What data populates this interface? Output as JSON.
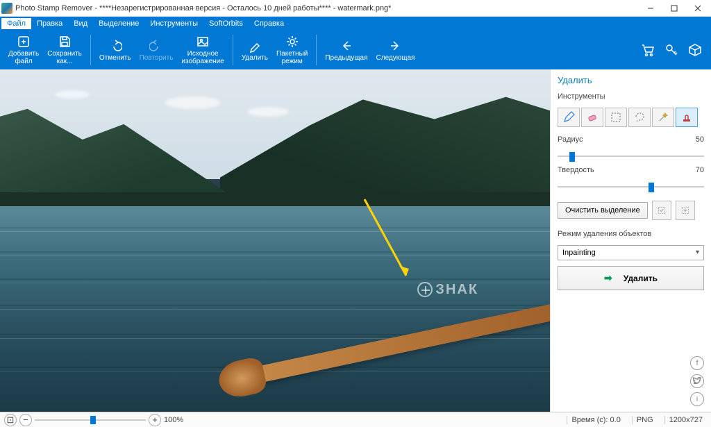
{
  "window": {
    "title": "Photo Stamp Remover - ****Незарегистрированная версия - Осталось 10 дней работы**** - watermark.png*"
  },
  "menu": {
    "file": "Файл",
    "edit": "Правка",
    "view": "Вид",
    "selection": "Выделение",
    "tools": "Инструменты",
    "softorbits": "SoftOrbits",
    "help": "Справка"
  },
  "ribbon": {
    "add_file": "Добавить\nфайл",
    "save_as": "Сохранить\nкак...",
    "undo": "Отменить",
    "redo": "Повторить",
    "original": "Исходное\nизображение",
    "remove": "Удалить",
    "batch": "Пакетный\nрежим",
    "prev": "Предыдущая",
    "next": "Следующая"
  },
  "panel": {
    "title": "Удалить",
    "tools_label": "Инструменты",
    "radius_label": "Радиус",
    "radius_value": "50",
    "hardness_label": "Твердость",
    "hardness_value": "70",
    "clear_selection": "Очистить выделение",
    "removal_mode_label": "Режим удаления объектов",
    "removal_mode_value": "Inpainting",
    "remove_button": "Удалить"
  },
  "canvas": {
    "watermark_text": "ЗНАК"
  },
  "status": {
    "zoom_percent": "100%",
    "time_label": "Время (с): 0.0",
    "format": "PNG",
    "dimensions": "1200x727"
  }
}
